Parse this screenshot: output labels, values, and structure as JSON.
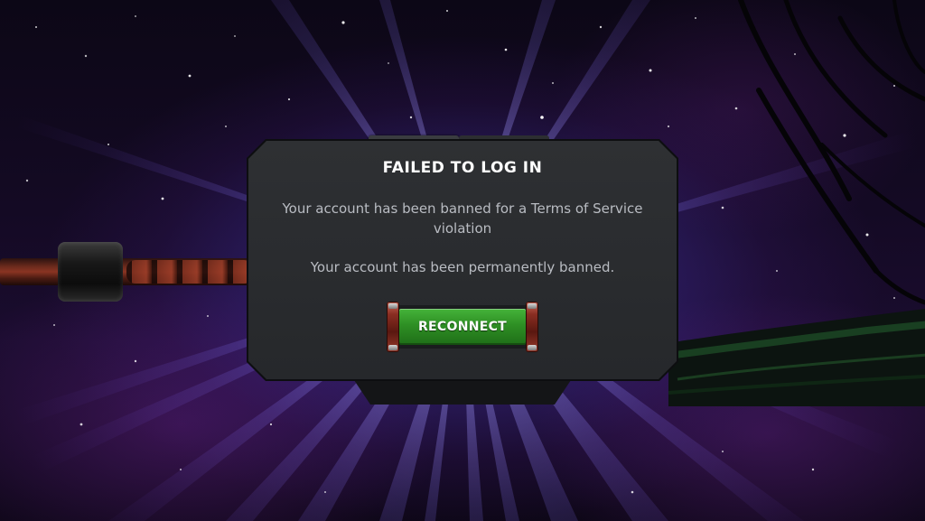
{
  "dialog": {
    "title": "FAILED TO LOG IN",
    "message_1": "Your account has been banned for a Terms of Service violation",
    "message_2": "Your account has been permanently banned.",
    "reconnect_label": "RECONNECT"
  },
  "colors": {
    "dialog_background": "#2a2c2f",
    "title_text": "#ffffff",
    "body_text": "#b9bcc2",
    "button_green": "#2e8f24",
    "button_caps": "#8a2e22"
  }
}
